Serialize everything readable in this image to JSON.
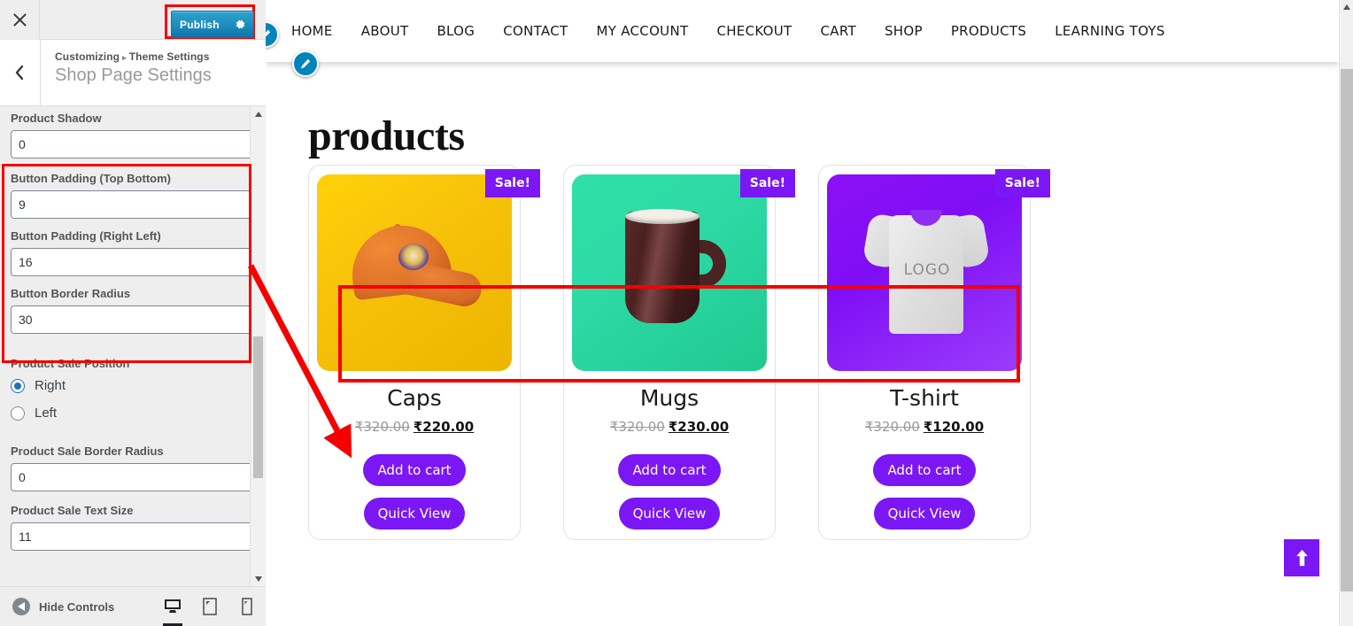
{
  "customizer": {
    "close_icon": "close-icon",
    "publish_label": "Publish",
    "publish_gear_icon": "gear-icon",
    "back_icon": "chevron-left-icon",
    "breadcrumb_root": "Customizing",
    "breadcrumb_sep": "▸",
    "breadcrumb_section": "Theme Settings",
    "panel_title": "Shop Page Settings",
    "controls": [
      {
        "label": "Product Shadow",
        "value": "0",
        "type": "number"
      },
      {
        "label": "Button Padding (Top Bottom)",
        "value": "9",
        "type": "number"
      },
      {
        "label": "Button Padding (Right Left)",
        "value": "16",
        "type": "number"
      },
      {
        "label": "Button Border Radius",
        "value": "30",
        "type": "number"
      },
      {
        "label": "Product Sale Border Radius",
        "value": "0",
        "type": "number"
      },
      {
        "label": "Product Sale Text Size",
        "value": "11",
        "type": "number"
      }
    ],
    "sale_position": {
      "label": "Product Sale Position",
      "options": [
        {
          "label": "Right",
          "selected": true
        },
        {
          "label": "Left",
          "selected": false
        }
      ]
    },
    "footer": {
      "hide_controls_label": "Hide Controls",
      "hide_icon": "collapse-left-icon",
      "devices": [
        {
          "name": "desktop-icon",
          "active": true
        },
        {
          "name": "tablet-icon",
          "active": false
        },
        {
          "name": "mobile-icon",
          "active": false
        }
      ]
    }
  },
  "preview": {
    "nav_items": [
      "HOME",
      "ABOUT",
      "BLOG",
      "CONTACT",
      "MY ACCOUNT",
      "CHECKOUT",
      "CART",
      "SHOP",
      "PRODUCTS",
      "LEARNING TOYS"
    ],
    "edit_shortcut_icon": "pencil-edit-icon",
    "page_heading": "products",
    "sale_badge_label": "Sale!",
    "add_to_cart_label": "Add to cart",
    "quick_view_label": "Quick View",
    "tshirt_graphic_text": "LOGO",
    "to_top_icon": "arrow-up-icon",
    "products": [
      {
        "title": "Caps",
        "price_old": "₹320.00",
        "price_new": "₹220.00",
        "image": "orange-cap-on-yellow",
        "on_sale": true
      },
      {
        "title": "Mugs",
        "price_old": "₹320.00",
        "price_new": "₹230.00",
        "image": "brown-mug-on-teal",
        "on_sale": true
      },
      {
        "title": "T-shirt",
        "price_old": "₹320.00",
        "price_new": "₹120.00",
        "image": "grey-tshirt-on-purple",
        "on_sale": true
      }
    ]
  },
  "colors": {
    "accent_purple": "#7b16f5",
    "publish_blue": "#1e8cbe",
    "annotation_red": "#f40000",
    "radio_blue": "#2271b1"
  }
}
